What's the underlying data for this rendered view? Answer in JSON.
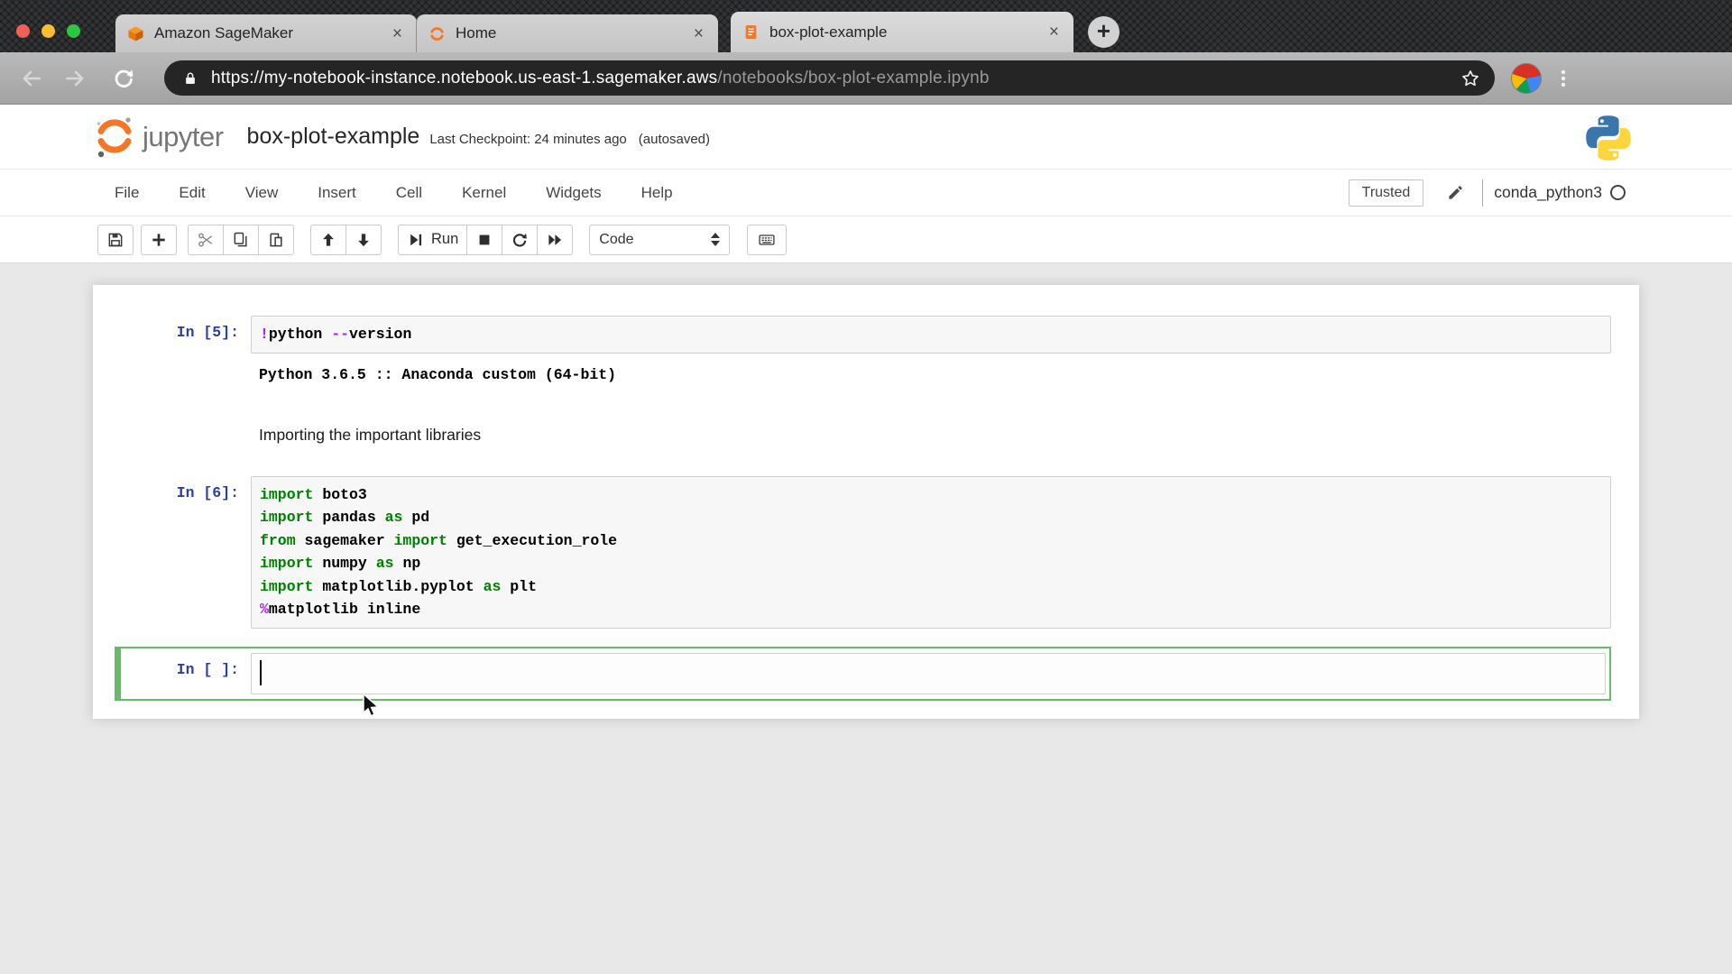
{
  "browser": {
    "tabs": [
      {
        "title": "Amazon SageMaker",
        "icon": "sagemaker-cube-icon",
        "close": "×"
      },
      {
        "title": "Home",
        "icon": "jupyter-ring-icon",
        "close": "×"
      },
      {
        "title": "box-plot-example",
        "icon": "notebook-doc-icon",
        "close": "×"
      }
    ],
    "new_tab_label": "+",
    "url": {
      "host_part": "https://my-notebook-instance.notebook.us-east-1.sagemaker.aws",
      "path_part": "/notebooks/box-plot-example.ipynb"
    }
  },
  "header": {
    "logo_text": "jupyter",
    "title": "box-plot-example",
    "checkpoint": "Last Checkpoint: 24 minutes ago",
    "autosaved": "(autosaved)"
  },
  "menu": {
    "items": [
      "File",
      "Edit",
      "View",
      "Insert",
      "Cell",
      "Kernel",
      "Widgets",
      "Help"
    ],
    "trusted_label": "Trusted",
    "kernel_name": "conda_python3"
  },
  "toolbar": {
    "run_label": "Run",
    "cell_type_value": "Code"
  },
  "notebook": {
    "cells": [
      {
        "type": "code",
        "prompt": "In [5]:",
        "lines": [
          [
            {
              "t": "op",
              "v": "!"
            },
            {
              "t": "p",
              "v": "python "
            },
            {
              "t": "op",
              "v": "--"
            },
            {
              "t": "p",
              "v": "version"
            }
          ]
        ],
        "output": "Python 3.6.5 :: Anaconda custom (64-bit)"
      },
      {
        "type": "markdown",
        "text": "Importing the important libraries"
      },
      {
        "type": "code",
        "prompt": "In [6]:",
        "lines": [
          [
            {
              "t": "kw",
              "v": "import"
            },
            {
              "t": "p",
              "v": " boto3"
            }
          ],
          [
            {
              "t": "kw",
              "v": "import"
            },
            {
              "t": "p",
              "v": " pandas "
            },
            {
              "t": "kw",
              "v": "as"
            },
            {
              "t": "p",
              "v": " pd"
            }
          ],
          [
            {
              "t": "kw",
              "v": "from"
            },
            {
              "t": "p",
              "v": " sagemaker "
            },
            {
              "t": "kw",
              "v": "import"
            },
            {
              "t": "p",
              "v": " get_execution_role"
            }
          ],
          [
            {
              "t": "kw",
              "v": "import"
            },
            {
              "t": "p",
              "v": " numpy "
            },
            {
              "t": "kw",
              "v": "as"
            },
            {
              "t": "p",
              "v": " np"
            }
          ],
          [
            {
              "t": "kw",
              "v": "import"
            },
            {
              "t": "p",
              "v": " matplotlib.pyplot "
            },
            {
              "t": "kw",
              "v": "as"
            },
            {
              "t": "p",
              "v": " plt"
            }
          ],
          [
            {
              "t": "op",
              "v": "%"
            },
            {
              "t": "p",
              "v": "matplotlib inline"
            }
          ]
        ]
      },
      {
        "type": "code",
        "prompt": "In [ ]:",
        "selected": true,
        "lines": []
      }
    ]
  },
  "colors": {
    "prompt_blue": "#303F9F",
    "keyword_green": "#008000",
    "operator_purple": "#AA22FF",
    "selected_cell_green": "#66BB6A",
    "jupyter_orange": "#F37726"
  }
}
